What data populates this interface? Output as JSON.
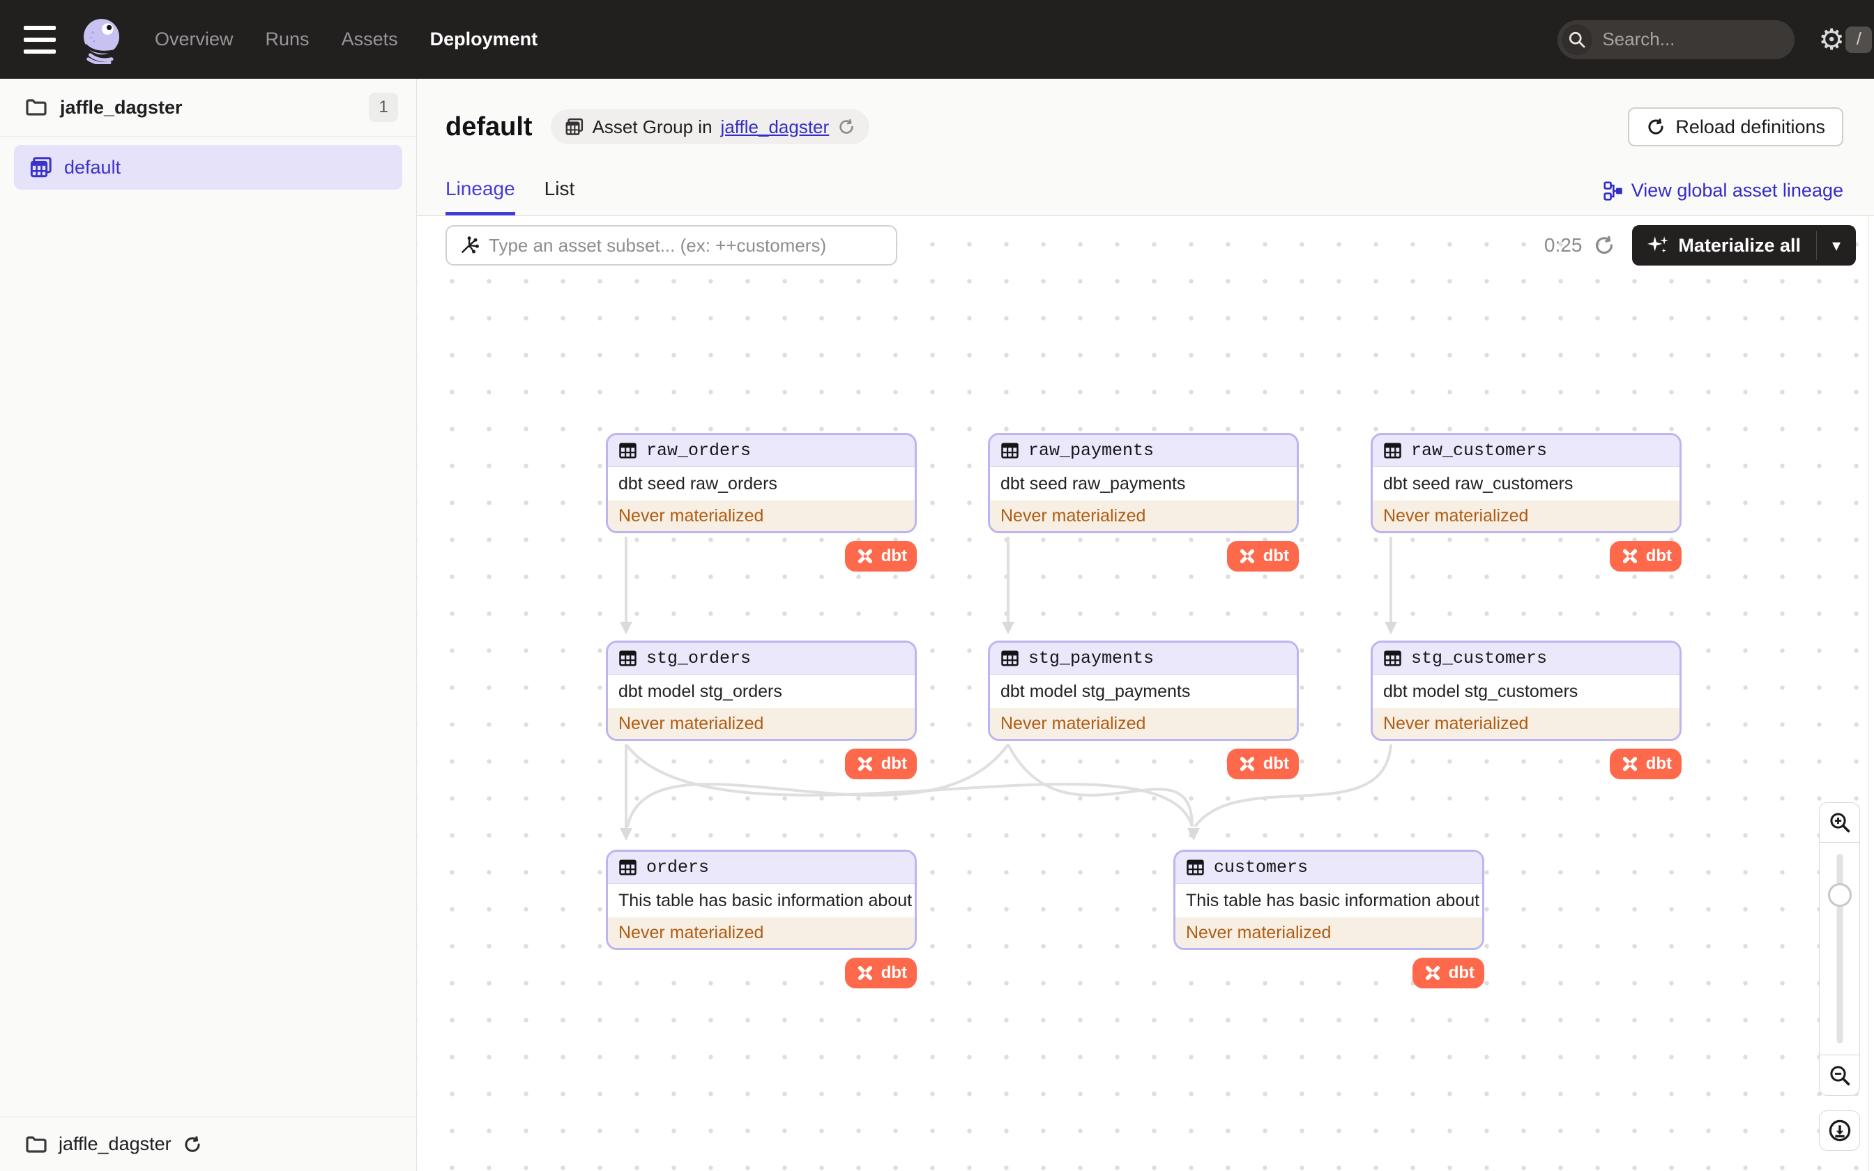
{
  "nav": {
    "items": [
      {
        "label": "Overview",
        "active": false
      },
      {
        "label": "Runs",
        "active": false
      },
      {
        "label": "Assets",
        "active": false
      },
      {
        "label": "Deployment",
        "active": true
      }
    ],
    "search": {
      "placeholder": "Search...",
      "shortcut": "/"
    }
  },
  "sidebar": {
    "repo": {
      "name": "jaffle_dagster",
      "count": "1"
    },
    "group": {
      "label": "default",
      "selected": true
    },
    "footer": {
      "name": "jaffle_dagster"
    }
  },
  "header": {
    "title": "default",
    "context": {
      "prefix": "Asset Group in",
      "link": "jaffle_dagster"
    },
    "reload_button": "Reload definitions",
    "tabs": [
      {
        "label": "Lineage",
        "active": true
      },
      {
        "label": "List",
        "active": false
      }
    ],
    "global_lineage_link": "View global asset lineage"
  },
  "toolbar": {
    "subset_placeholder": "Type an asset subset... (ex: ++customers)",
    "timer": "0:25",
    "materialize_button": "Materialize all"
  },
  "graph": {
    "nodes": [
      {
        "name": "raw_orders",
        "description": "dbt seed raw_orders",
        "status": "Never materialized",
        "badge": "dbt"
      },
      {
        "name": "raw_payments",
        "description": "dbt seed raw_payments",
        "status": "Never materialized",
        "badge": "dbt"
      },
      {
        "name": "raw_customers",
        "description": "dbt seed raw_customers",
        "status": "Never materialized",
        "badge": "dbt"
      },
      {
        "name": "stg_orders",
        "description": "dbt model stg_orders",
        "status": "Never materialized",
        "badge": "dbt"
      },
      {
        "name": "stg_payments",
        "description": "dbt model stg_payments",
        "status": "Never materialized",
        "badge": "dbt"
      },
      {
        "name": "stg_customers",
        "description": "dbt model stg_customers",
        "status": "Never materialized",
        "badge": "dbt"
      },
      {
        "name": "orders",
        "description": "This table has basic information about ...",
        "status": "Never materialized",
        "badge": "dbt"
      },
      {
        "name": "customers",
        "description": "This table has basic information about ...",
        "status": "Never materialized",
        "badge": "dbt"
      }
    ]
  },
  "colors": {
    "accent": "#443CD6",
    "link": "#342EC5",
    "dbt_orange": "#FF694B",
    "status_text": "#B05C12",
    "status_bg": "#F7EFE4",
    "node_border": "#BBB5F0",
    "node_header_bg": "#EAE8FA",
    "edge": "#E0DFDE",
    "nav_bg": "#221F1F"
  }
}
